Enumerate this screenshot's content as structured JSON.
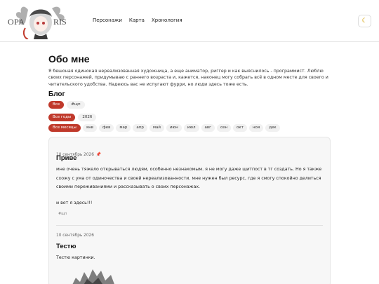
{
  "header": {
    "logo_text": "OPALIS",
    "nav": [
      "Персонажи",
      "Карта",
      "Хронология"
    ],
    "theme_icon": "moon-icon"
  },
  "page": {
    "title": "Обо мне",
    "about": "Я бешоная одинокая нереализованная художница, а еще аниматор, риггер и как выяснилось - программист. Люблю своих персонажей, придумываю с раннего возраста и, кажется, наконец могу собрать всё в одном месте для своего и читательского удобства. Надеюсь вас не испугают фурри, но люди здесь тоже есть.",
    "blog_heading": "Блог"
  },
  "filters": {
    "tags": [
      "Все",
      "#щп"
    ],
    "years": [
      "Все годы",
      "2026"
    ],
    "months": [
      "Все месяцы",
      "янв",
      "фев",
      "мар",
      "апр",
      "май",
      "июн",
      "июл",
      "авг",
      "сен",
      "окт",
      "ноя",
      "дек"
    ]
  },
  "posts": [
    {
      "date": "10 сентябрь 2026",
      "pin_icon": "pin-icon",
      "title": "Приве",
      "body_lines": [
        "мне очень тяжело открываться людям, особенно незнакомым. я не могу даже щитпост в тг создать. Но я также",
        "схожу с ума от одиночества и своей нереализованности. мне нужен был ресурс, где я смогу спокойно делиться",
        "своими переживаниями и рассказывать о своих персонажах.",
        "",
        "и вот я здесь!!!"
      ],
      "tag": "#щп"
    },
    {
      "date": "10 сентябрь 2026",
      "title": "Тестю",
      "body_lines": [
        "Тестю картинки."
      ]
    }
  ],
  "colors": {
    "accent": "#c0392b",
    "pill_bg": "#f1f1f1",
    "feed_bg": "#f7f7f7"
  }
}
